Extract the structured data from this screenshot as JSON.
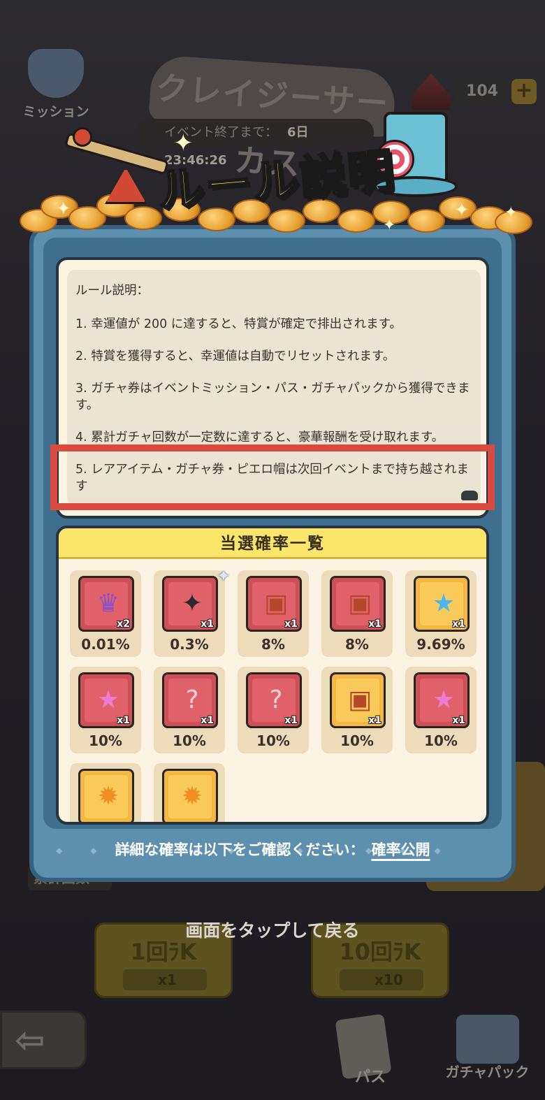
{
  "background": {
    "mission_label": "ミッション",
    "event_title": "クレイジーサーカス",
    "event_timer_label": "イベント終了まで：",
    "event_timer_value": "6日 23:46:26",
    "currency_count": "104",
    "currency_plus": "+",
    "cumulative_label": "累計回数",
    "pull_single_label": "1回ﾗK",
    "pull_single_cost": "x1",
    "pull_ten_label": "10回ﾗK",
    "pull_ten_cost": "x10",
    "back_arrow": "⇦",
    "nav_pass_label": "パス",
    "nav_gacha_pack_label": "ガチャパック"
  },
  "modal": {
    "title": "ルール説明",
    "rules": {
      "heading": "ルール説明：",
      "items": [
        "1. 幸運値が 200 に達すると、特賞が確定で排出されます。",
        "2. 特賞を獲得すると、幸運値は自動でリセットされます。",
        "3. ガチャ券はイベントミッション・パス・ガチャパックから獲得できます。",
        "4. 累計ガチャ回数が一定数に達すると、豪華報酬を受け取れます。",
        "5. レアアイテム・ガチャ券・ピエロ帽は次回イベントまで持ち越されます"
      ]
    },
    "probabilities": {
      "header": "当選確率一覧",
      "items": [
        {
          "icon": "jester-hat-icon",
          "bg": "red",
          "glyph": "♛",
          "qty": "x2",
          "rate": "0.01%"
        },
        {
          "icon": "shuriken-icon",
          "bg": "red",
          "glyph": "✦",
          "qty": "x1",
          "rate": "0.3%"
        },
        {
          "icon": "treasure-chest-icon",
          "bg": "red",
          "glyph": "▣",
          "qty": "x1",
          "rate": "8%"
        },
        {
          "icon": "treasure-chest-icon",
          "bg": "red",
          "glyph": "▣",
          "qty": "x1",
          "rate": "8%"
        },
        {
          "icon": "blue-star-wand-icon",
          "bg": "gold",
          "glyph": "★",
          "qty": "x1",
          "rate": "9.69%"
        },
        {
          "icon": "pink-star-wand-icon",
          "bg": "red",
          "glyph": "★",
          "qty": "x1",
          "rate": "10%"
        },
        {
          "icon": "mystery-puzzle-icon",
          "bg": "red",
          "glyph": "?",
          "qty": "x1",
          "rate": "10%"
        },
        {
          "icon": "mystery-puzzle-icon",
          "bg": "red",
          "glyph": "?",
          "qty": "x1",
          "rate": "10%"
        },
        {
          "icon": "gold-chest-icon",
          "bg": "gold",
          "glyph": "▣",
          "qty": "x1",
          "rate": "10%"
        },
        {
          "icon": "pink-star-wand-icon",
          "bg": "red",
          "glyph": "★",
          "qty": "x1",
          "rate": "10%"
        },
        {
          "icon": "spiky-ball-icon",
          "bg": "gold",
          "glyph": "✹",
          "qty": "",
          "rate": ""
        },
        {
          "icon": "spiky-ball-icon",
          "bg": "gold",
          "glyph": "✹",
          "qty": "",
          "rate": ""
        }
      ]
    },
    "footer_text": "詳細な確率は以下をご確認ください：",
    "footer_link": "確率公開"
  },
  "tap_to_return": "画面をタップして戻る",
  "colors": {
    "highlight": "#d84b3e",
    "title_yellow": "#ffe34d",
    "frame_blue": "#5d8fae"
  }
}
